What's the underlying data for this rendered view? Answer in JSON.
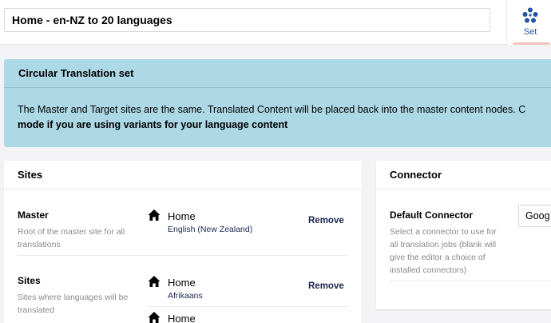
{
  "header": {
    "name_value": "Home - en-NZ to 20 languages",
    "set_tab_label": "Set",
    "set_icon": "network-nodes-icon"
  },
  "banner": {
    "title": "Circular Translation set",
    "line1": "The Master and Target sites are the same. Translated Content will be placed back into the master content nodes. C",
    "line2": "mode if you are using variants for your language content"
  },
  "sites_panel": {
    "title": "Sites",
    "master": {
      "label": "Master",
      "description": "Root of the master site for all translations",
      "items": [
        {
          "name": "Home",
          "language": "English (New Zealand)",
          "remove_label": "Remove"
        }
      ]
    },
    "sites": {
      "label": "Sites",
      "description": "Sites where languages will be translated",
      "items": [
        {
          "name": "Home",
          "language": "Afrikaans",
          "remove_label": "Remove"
        },
        {
          "name": "Home"
        }
      ]
    }
  },
  "connector_panel": {
    "title": "Connector",
    "label": "Default Connector",
    "description": "Select a connector to use for all translation jobs (blank will give the editor a choice of installed connectors)",
    "select_value": "Goog"
  },
  "colors": {
    "banner_bg": "#add8e6",
    "accent": "#2152a3",
    "tab_underline": "#f5c1bc"
  }
}
